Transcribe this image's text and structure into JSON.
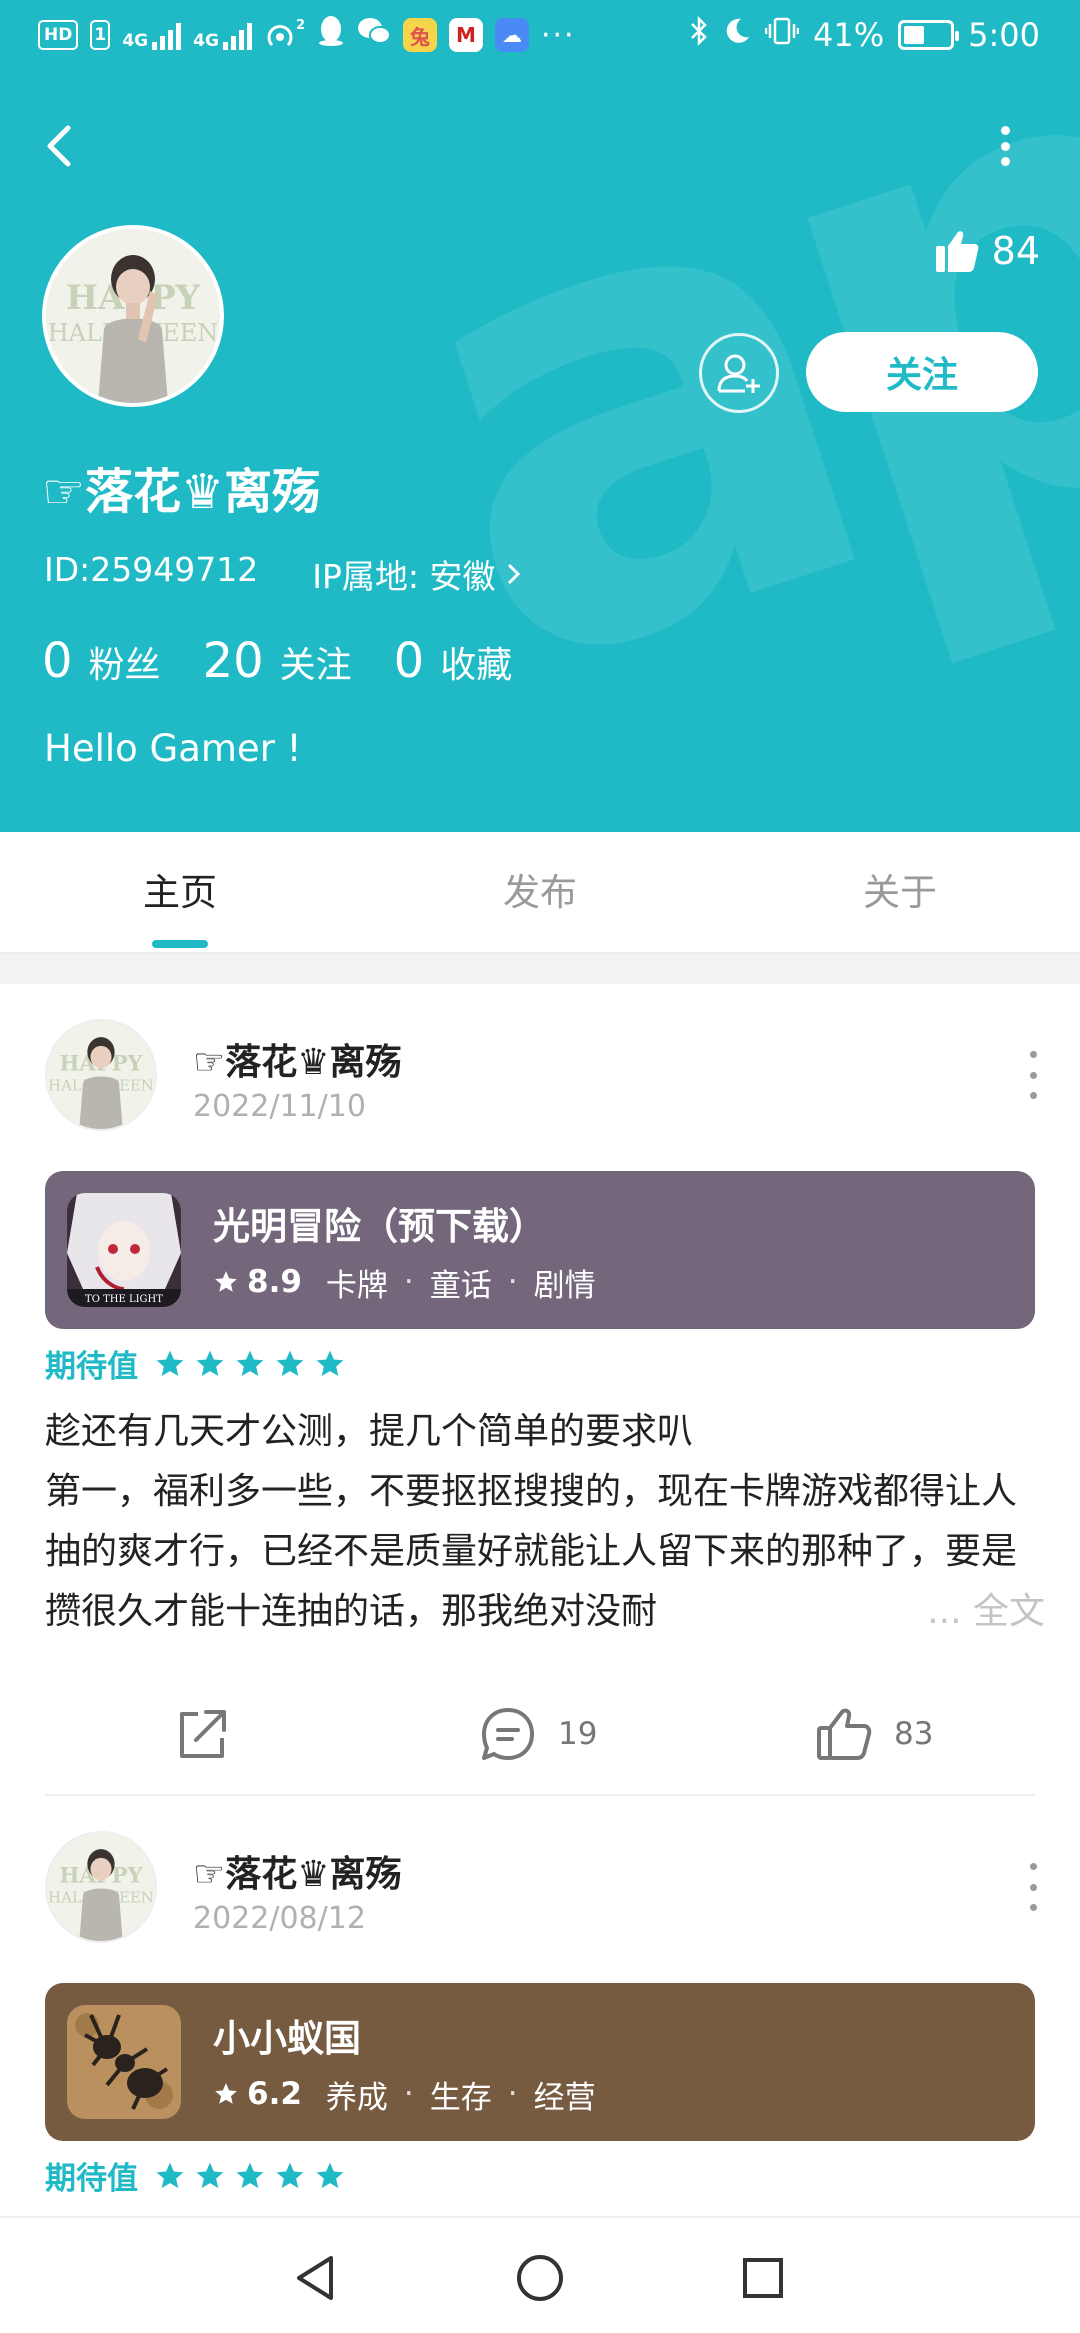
{
  "status_bar": {
    "left_chips": [
      "HD",
      "1"
    ],
    "net_a": "4G",
    "net_b": "4G",
    "hotspot_sup": "2",
    "more": "···",
    "battery_pct": "41%",
    "time": "5:00"
  },
  "profile": {
    "likes": "84",
    "follow_label": "关注",
    "username": "☞落花♛离殇",
    "id_text": "ID:25949712",
    "ip_text": "IP属地: 安徽",
    "stats": [
      {
        "num": "0",
        "label": "粉丝"
      },
      {
        "num": "20",
        "label": "关注"
      },
      {
        "num": "0",
        "label": "收藏"
      }
    ],
    "bio": "Hello Gamer !"
  },
  "tabs": [
    "主页",
    "发布",
    "关于"
  ],
  "posts": [
    {
      "author": "☞落花♛离殇",
      "date": "2022/11/10",
      "game": {
        "title": "光明冒险（预下载）",
        "score": "8.9",
        "tags": [
          "卡牌",
          "童话",
          "剧情"
        ],
        "icon_text": "TO THE LIGHT",
        "card_color": "#74677b"
      },
      "expect_label": "期待值",
      "stars": 5,
      "body_line1": "趁还有几天才公测，提几个简单的要求叭",
      "body_line2": "第一，福利多一些，不要抠抠搜搜的，现在卡牌游戏都得让人抽的爽才行，已经不是质量好就能让人留下来的那种了，要是攒很久才能十连抽的话，那我绝对没耐",
      "more": "... 全文",
      "comments": "19",
      "likes": "83"
    },
    {
      "author": "☞落花♛离殇",
      "date": "2022/08/12",
      "game": {
        "title": "小小蚁国",
        "score": "6.2",
        "tags": [
          "养成",
          "生存",
          "经营"
        ],
        "card_color": "#765b40"
      },
      "expect_label": "期待值",
      "stars": 5
    }
  ],
  "colors": {
    "accent": "#1fbac6",
    "header_bg": "#1fbac6"
  }
}
